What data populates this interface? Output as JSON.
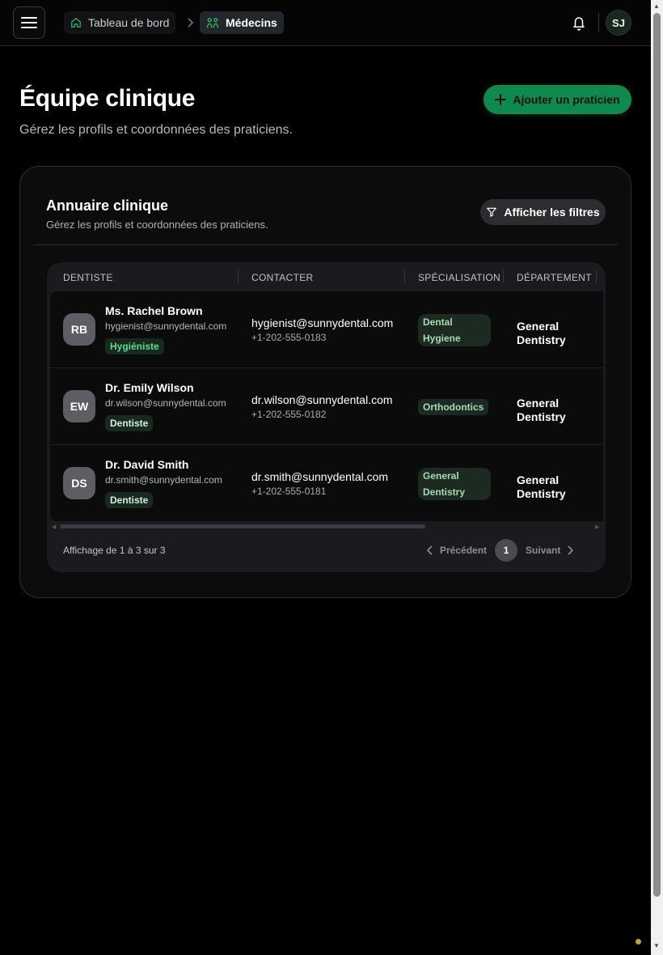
{
  "breadcrumb": {
    "home_label": "Tableau de bord",
    "current_label": "Médecins"
  },
  "user": {
    "initials": "SJ"
  },
  "header": {
    "title": "Équipe clinique",
    "subtitle": "Gérez les profils et coordonnées des praticiens.",
    "add_button_label": "Ajouter un praticien"
  },
  "directory": {
    "title": "Annuaire clinique",
    "subtitle": "Gérez les profils et coordonnées des praticiens.",
    "filters_button_label": "Afficher les filtres",
    "columns": [
      "DENTISTE",
      "CONTACTER",
      "SPÉCIALISATION",
      "DÉPARTEMENT"
    ],
    "rows": [
      {
        "initials": "RB",
        "name": "Ms. Rachel Brown",
        "email": "hygienist@sunnydental.com",
        "role": "Hygiéniste",
        "contact_email": "hygienist@sunnydental.com",
        "phone": "+1-202-555-0183",
        "specialization": "Dental Hygiene",
        "department": "General Dentistry"
      },
      {
        "initials": "EW",
        "name": "Dr. Emily Wilson",
        "email": "dr.wilson@sunnydental.com",
        "role": "Dentiste",
        "contact_email": "dr.wilson@sunnydental.com",
        "phone": "+1-202-555-0182",
        "specialization": "Orthodontics",
        "department": "General Dentistry"
      },
      {
        "initials": "DS",
        "name": "Dr. David Smith",
        "email": "dr.smith@sunnydental.com",
        "role": "Dentiste",
        "contact_email": "dr.smith@sunnydental.com",
        "phone": "+1-202-555-0181",
        "specialization": "General Dentistry",
        "department": "General Dentistry"
      }
    ],
    "footer_info": "Affichage de 1 à 3 sur 3",
    "pagination": {
      "prev_label": "Précédent",
      "current_page": "1",
      "next_label": "Suivant"
    }
  },
  "colors": {
    "accent": "#0e8a4f",
    "role_hygienist": "#5fdc8c",
    "background": "#000000"
  },
  "icons": [
    "menu-icon",
    "home-icon",
    "chevron-right-icon",
    "stethoscope-icon",
    "bell-icon",
    "plus-icon",
    "filter-icon",
    "chevron-left-icon"
  ]
}
